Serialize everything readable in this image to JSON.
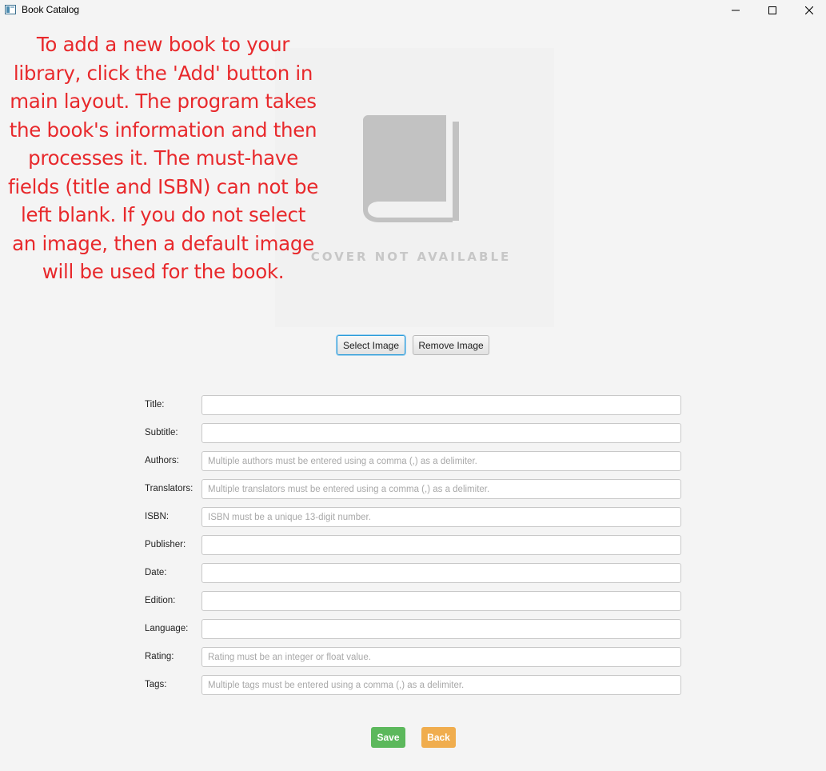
{
  "window": {
    "title": "Book Catalog"
  },
  "instruction": {
    "lines": [
      "To add a new book to your",
      "library, click the 'Add' button in",
      "main layout. The program takes",
      "the book's information and then",
      "processes it. The must-have",
      "fields (title and ISBN) can not be",
      "left blank. If you do not select",
      "an image, then a default image",
      "will be used for the book."
    ],
    "color": "#e8292c"
  },
  "cover": {
    "caption": "COVER NOT AVAILABLE",
    "icon": "book-icon"
  },
  "image_buttons": {
    "select_label": "Select Image",
    "remove_label": "Remove Image"
  },
  "form": {
    "fields": [
      {
        "label": "Title:",
        "value": "",
        "placeholder": ""
      },
      {
        "label": "Subtitle:",
        "value": "",
        "placeholder": ""
      },
      {
        "label": "Authors:",
        "value": "",
        "placeholder": "Multiple authors must be entered using a comma (,) as a delimiter."
      },
      {
        "label": "Translators:",
        "value": "",
        "placeholder": "Multiple translators must be entered using a comma (,) as a delimiter."
      },
      {
        "label": "ISBN:",
        "value": "",
        "placeholder": "ISBN must be a unique 13-digit number."
      },
      {
        "label": "Publisher:",
        "value": "",
        "placeholder": ""
      },
      {
        "label": "Date:",
        "value": "",
        "placeholder": ""
      },
      {
        "label": "Edition:",
        "value": "",
        "placeholder": ""
      },
      {
        "label": "Language:",
        "value": "",
        "placeholder": ""
      },
      {
        "label": "Rating:",
        "value": "",
        "placeholder": "Rating must be an integer or float value."
      },
      {
        "label": "Tags:",
        "value": "",
        "placeholder": "Multiple tags must be entered using a comma (,) as a delimiter."
      }
    ]
  },
  "actions": {
    "save_label": "Save",
    "back_label": "Back",
    "save_color": "#5cb85c",
    "back_color": "#f0ad4e"
  }
}
